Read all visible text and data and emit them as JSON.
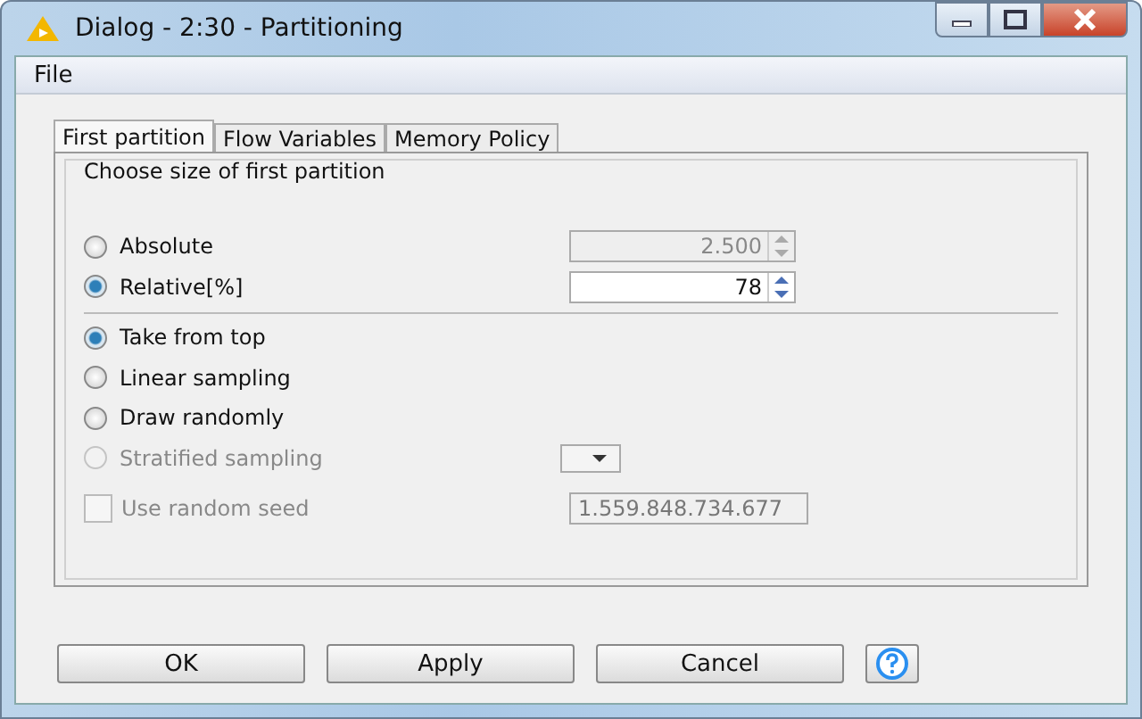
{
  "window": {
    "title": "Dialog - 2:30 - Partitioning"
  },
  "menu": [
    "File"
  ],
  "tabs": [
    {
      "label": "First partition",
      "selected": true
    },
    {
      "label": "Flow Variables",
      "selected": false
    },
    {
      "label": "Memory Policy",
      "selected": false
    }
  ],
  "group": {
    "title": "Choose size of first partition"
  },
  "size_options": [
    {
      "label": "Absolute",
      "selected": false,
      "value": "2.500",
      "field_disabled": true
    },
    {
      "label": "Relative[%]",
      "selected": true,
      "value": "78",
      "field_disabled": false
    }
  ],
  "sampling_options": [
    {
      "kind": "plain",
      "label": "Take from top",
      "selected": true,
      "disabled": false
    },
    {
      "kind": "plain",
      "label": "Linear sampling",
      "selected": false,
      "disabled": false
    },
    {
      "kind": "plain",
      "label": "Draw randomly",
      "selected": false,
      "disabled": false
    },
    {
      "kind": "dropdown",
      "label": "Stratified sampling",
      "selected": false,
      "disabled": true
    }
  ],
  "seed": {
    "label": "Use random seed",
    "checked": false,
    "disabled": true,
    "value": "1.559.848.734.677"
  },
  "buttons": [
    "OK",
    "Apply",
    "Cancel"
  ]
}
